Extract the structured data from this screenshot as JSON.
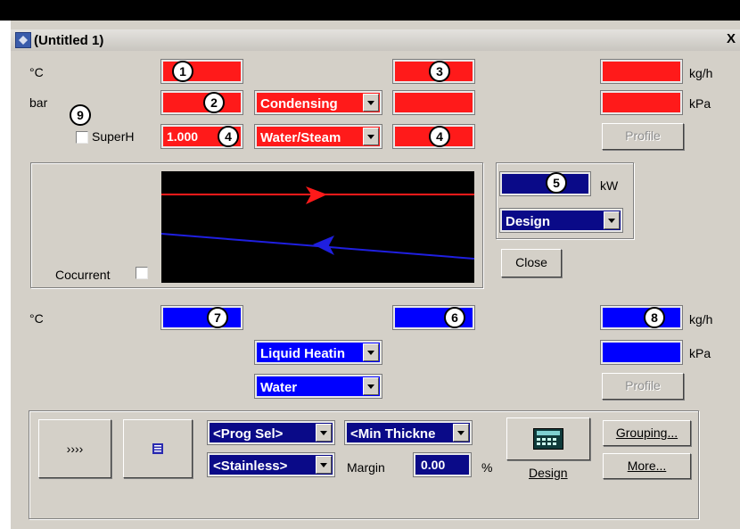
{
  "window": {
    "title": "(Untitled 1)",
    "close_glyph": "X",
    "icon": "app-icon"
  },
  "hot": {
    "temp_unit": "°C",
    "press_unit": "bar",
    "superh_label": "SuperH",
    "superh_checked": false,
    "field1_badge": "1",
    "field2_badge": "2",
    "field3_badge": "3",
    "quality_value": "1.000",
    "quality_badge": "4",
    "outlet_quality_badge": "4",
    "superh_badge": "9",
    "process_type": "Condensing",
    "fluid": "Water/Steam",
    "flow_unit": "kg/h",
    "dp_unit": "kPa",
    "profile_label": "Profile",
    "color": "#ff1a1a"
  },
  "schematic": {
    "cocurrent_label": "Cocurrent",
    "cocurrent_checked": false,
    "hot_line_color": "#ff1a1a",
    "cold_line_color": "#1f1fe0"
  },
  "duty": {
    "badge": "5",
    "unit": "kW",
    "mode": "Design",
    "close_label": "Close"
  },
  "cold": {
    "temp_unit": "°C",
    "inlet_badge": "7",
    "outlet_badge": "6",
    "flow_badge": "8",
    "flow_unit": "kg/h",
    "dp_unit": "kPa",
    "process_type": "Liquid Heatin",
    "fluid": "Water",
    "profile_label": "Profile",
    "color": "#0000ff"
  },
  "bottom": {
    "arrows_label": "››››",
    "doc_icon": "document-icon",
    "prog_sel": "<Prog Sel>",
    "min_thickness": "<Min Thickne",
    "material": "<Stainless>",
    "margin_label": "Margin",
    "margin_value": "0.00",
    "margin_unit": "%",
    "design_label": "Design",
    "design_icon": "calculator-icon",
    "grouping_label": "Grouping...",
    "more_label": "More..."
  }
}
